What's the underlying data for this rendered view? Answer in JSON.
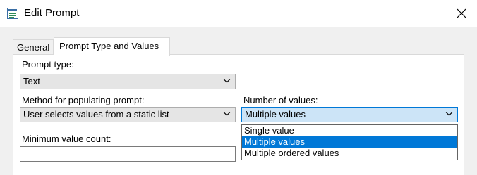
{
  "window": {
    "title": "Edit Prompt"
  },
  "tabs": [
    {
      "label": "General"
    },
    {
      "label": "Prompt Type and Values"
    }
  ],
  "form": {
    "prompt_type": {
      "label": "Prompt type:",
      "value": "Text"
    },
    "method": {
      "label": "Method for populating prompt:",
      "value": "User selects values from a static list"
    },
    "number_of_values": {
      "label": "Number of values:",
      "value": "Multiple values",
      "options": [
        "Single value",
        "Multiple values",
        "Multiple ordered values"
      ],
      "highlighted": "Multiple values"
    },
    "min_count": {
      "label": "Minimum value count:",
      "value": ""
    }
  },
  "icons": {
    "app": "prompt-form-icon",
    "close": "close-icon",
    "dropdown": "chevron-down-icon"
  },
  "colors": {
    "highlight": "#0078d7",
    "open_combo_fill": "#cce4f7"
  }
}
